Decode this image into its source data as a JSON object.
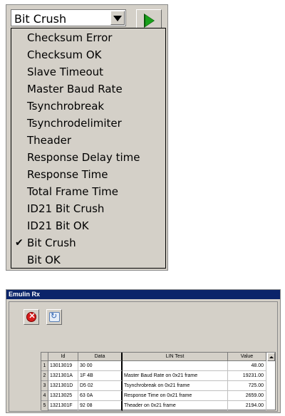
{
  "combo": {
    "value": "Bit Crush"
  },
  "dropdown": {
    "items": [
      {
        "label": "Checksum Error",
        "checked": false
      },
      {
        "label": "Checksum OK",
        "checked": false
      },
      {
        "label": "Slave Timeout",
        "checked": false
      },
      {
        "label": "Master Baud Rate",
        "checked": false
      },
      {
        "label": "Tsynchrobreak",
        "checked": false
      },
      {
        "label": "Tsynchrodelimiter",
        "checked": false
      },
      {
        "label": "Theader",
        "checked": false
      },
      {
        "label": "Response Delay time",
        "checked": false
      },
      {
        "label": "Response Time",
        "checked": false
      },
      {
        "label": "Total Frame Time",
        "checked": false
      },
      {
        "label": "ID21 Bit Crush",
        "checked": false
      },
      {
        "label": "ID21 Bit OK",
        "checked": false
      },
      {
        "label": "Bit Crush",
        "checked": true
      },
      {
        "label": "Bit OK",
        "checked": false
      }
    ],
    "check_mark": "✔"
  },
  "window": {
    "title": "Emulin Rx",
    "toolbar": {
      "stop_glyph": "✕",
      "refresh_glyph": "↻"
    },
    "table": {
      "headers": {
        "id": "Id",
        "data": "Data",
        "lin_test": "LIN Test",
        "value": "Value"
      },
      "rows": [
        {
          "n": "1",
          "id": "13013019",
          "data": "30 00",
          "lin_test": "",
          "value": "48.00"
        },
        {
          "n": "2",
          "id": "1321301A",
          "data": "1F 4B",
          "lin_test": "Master Baud Rate on 0x21 frame",
          "value": "19231.00"
        },
        {
          "n": "3",
          "id": "1321301D",
          "data": "D5 02",
          "lin_test": "Tsynchrobreak on 0x21 frame",
          "value": "725.00"
        },
        {
          "n": "4",
          "id": "13213025",
          "data": "63 0A",
          "lin_test": "Response Time on 0x21 frame",
          "value": "2659.00"
        },
        {
          "n": "5",
          "id": "1321301F",
          "data": "92 08",
          "lin_test": "Theader on 0x21 frame",
          "value": "2194.00"
        }
      ]
    }
  },
  "colors": {
    "play_green": "#19a11b",
    "stop_red": "#d81c1c",
    "title_bar": "#0a246a"
  }
}
